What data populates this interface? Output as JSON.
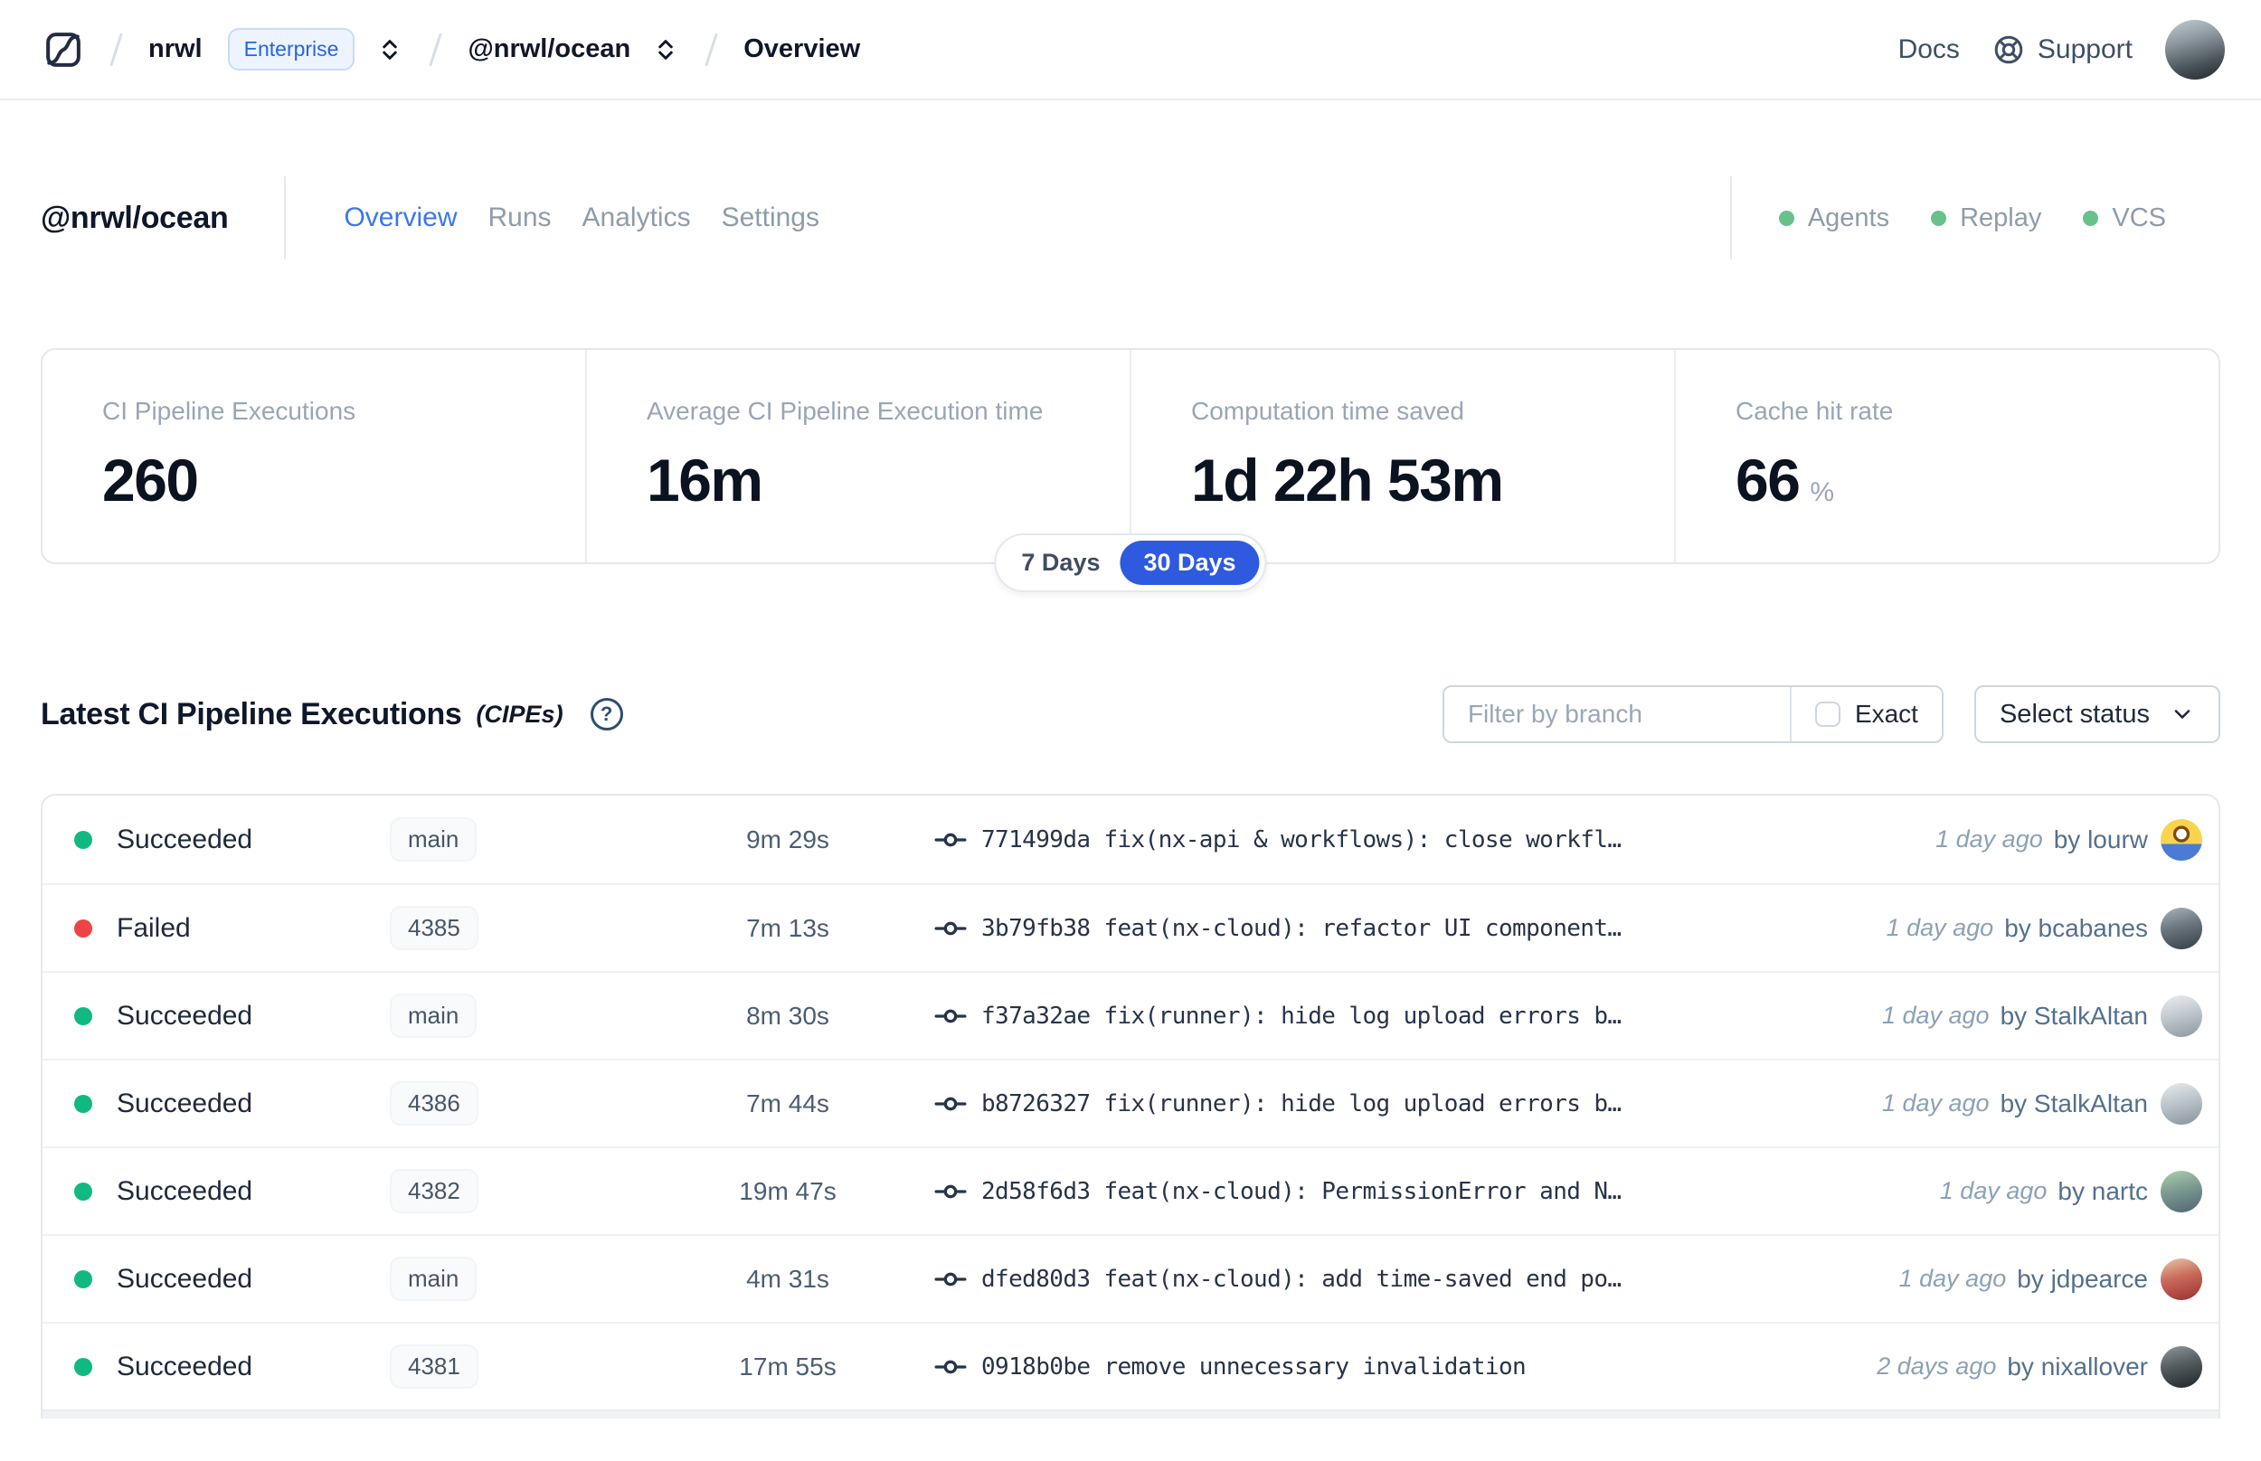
{
  "nav": {
    "breadcrumb": {
      "org": "nrwl",
      "org_badge": "Enterprise",
      "workspace": "@nrwl/ocean",
      "page": "Overview"
    },
    "links": {
      "docs": "Docs",
      "support": "Support"
    }
  },
  "header": {
    "title": "@nrwl/ocean",
    "tabs": [
      {
        "label": "Overview",
        "active": true
      },
      {
        "label": "Runs",
        "active": false
      },
      {
        "label": "Analytics",
        "active": false
      },
      {
        "label": "Settings",
        "active": false
      }
    ],
    "status_links": [
      {
        "label": "Agents"
      },
      {
        "label": "Replay"
      },
      {
        "label": "VCS"
      }
    ],
    "status_dot_color": "#68c18a",
    "active_tab_color": "#3b76f0"
  },
  "stats": {
    "cards": [
      {
        "label": "CI Pipeline Executions",
        "value": "260",
        "suffix": ""
      },
      {
        "label": "Average CI Pipeline Execution time",
        "value": "16m",
        "suffix": ""
      },
      {
        "label": "Computation time saved",
        "value": "1d 22h 53m",
        "suffix": ""
      },
      {
        "label": "Cache hit rate",
        "value": "66",
        "suffix": "%"
      }
    ],
    "range_toggle": {
      "options": [
        "7 Days",
        "30 Days"
      ],
      "selected": "30 Days",
      "selected_color": "#2e5ae0"
    }
  },
  "section": {
    "title": "Latest CI Pipeline Executions",
    "title_suffix": "(CIPEs)",
    "filter": {
      "placeholder": "Filter by branch",
      "exact_label": "Exact",
      "exact_checked": false,
      "status_button": "Select status"
    }
  },
  "table": {
    "rows": [
      {
        "status": "Succeeded",
        "status_color": "#10b981",
        "branch": "main",
        "duration": "9m 29s",
        "commit_sha": "771499da",
        "commit_msg": "fix(nx-api & workflows): close workfl…",
        "time": "1 day ago",
        "author": "by lourw"
      },
      {
        "status": "Failed",
        "status_color": "#ef4444",
        "branch": "4385",
        "duration": "7m 13s",
        "commit_sha": "3b79fb38",
        "commit_msg": "feat(nx-cloud): refactor UI component…",
        "time": "1 day ago",
        "author": "by bcabanes"
      },
      {
        "status": "Succeeded",
        "status_color": "#10b981",
        "branch": "main",
        "duration": "8m 30s",
        "commit_sha": "f37a32ae",
        "commit_msg": "fix(runner): hide log upload errors b…",
        "time": "1 day ago",
        "author": "by StalkAltan"
      },
      {
        "status": "Succeeded",
        "status_color": "#10b981",
        "branch": "4386",
        "duration": "7m 44s",
        "commit_sha": "b8726327",
        "commit_msg": "fix(runner): hide log upload errors b…",
        "time": "1 day ago",
        "author": "by StalkAltan"
      },
      {
        "status": "Succeeded",
        "status_color": "#10b981",
        "branch": "4382",
        "duration": "19m 47s",
        "commit_sha": "2d58f6d3",
        "commit_msg": "feat(nx-cloud): PermissionError and N…",
        "time": "1 day ago",
        "author": "by nartc"
      },
      {
        "status": "Succeeded",
        "status_color": "#10b981",
        "branch": "main",
        "duration": "4m 31s",
        "commit_sha": "dfed80d3",
        "commit_msg": "feat(nx-cloud): add time-saved end po…",
        "time": "1 day ago",
        "author": "by jdpearce"
      },
      {
        "status": "Succeeded",
        "status_color": "#10b981",
        "branch": "4381",
        "duration": "17m 55s",
        "commit_sha": "0918b0be",
        "commit_msg": "remove unnecessary invalidation",
        "time": "2 days ago",
        "author": "by nixallover"
      }
    ]
  }
}
